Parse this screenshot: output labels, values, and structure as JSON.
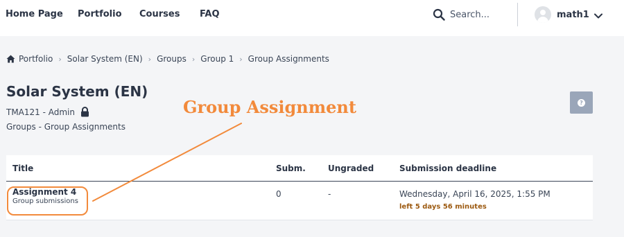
{
  "nav": {
    "links": [
      "Home Page",
      "Portfolio",
      "Courses",
      "FAQ"
    ],
    "search_placeholder": "Search...",
    "user_name": "math1"
  },
  "breadcrumb": [
    "Portfolio",
    "Solar System (EN)",
    "Groups",
    "Group 1",
    "Group Assignments"
  ],
  "header": {
    "title": "Solar System (EN)",
    "course_code": "TMA121 - Admin",
    "subtitle": "Groups - Group Assignments"
  },
  "table": {
    "columns": [
      "Title",
      "Subm.",
      "Ungraded",
      "Submission deadline"
    ],
    "rows": [
      {
        "title": "Assignment 4",
        "subtitle": "Group submissions",
        "submissions": "0",
        "ungraded": "-",
        "deadline": "Wednesday, April 16, 2025, 1:55 PM",
        "time_left": "left 5 days 56 minutes"
      }
    ]
  },
  "annotation": {
    "label": "Group Assignment",
    "color": "#f28a3b"
  },
  "colors": {
    "deadline_warning": "#9c5a11",
    "help_button": "#9aa6b9"
  }
}
